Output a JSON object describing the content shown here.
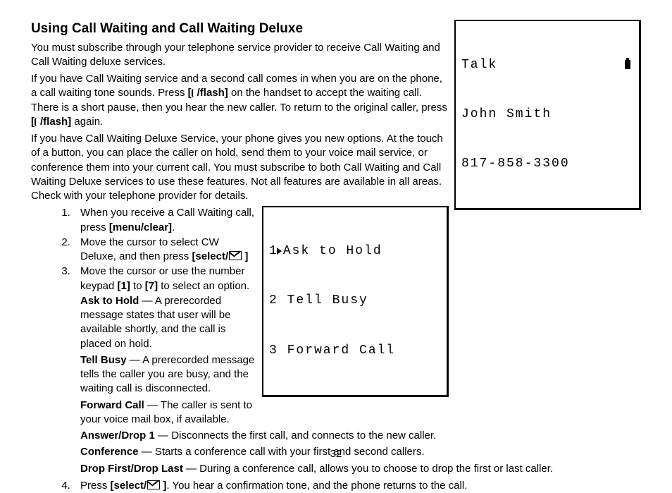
{
  "heading": "Using Call Waiting and Call Waiting Deluxe",
  "p1": "You must subscribe through your telephone service provider to receive Call Waiting and Call Waiting deluxe services.",
  "p2a": "If you have Call Waiting service and a second call comes in when you are on the phone, a call waiting tone sounds. Press ",
  "flash": "/flash]",
  "p2b": " on the handset to accept the waiting call. There is a short pause, then you hear the new caller. To return to the original caller, press ",
  "p2c": " again.",
  "p3": "If you have Call Waiting Deluxe Service, your phone gives you new options. At the touch of a button, you can place the caller on hold, send them to your voice mail service, or conference them into your current call. You must subscribe to both Call Waiting and Call Waiting Deluxe services to use these features. Not all features are available in all areas. Check with your telephone provider for details.",
  "screen1": {
    "l1": "Talk",
    "l2": "John Smith",
    "l3": "817-858-3300"
  },
  "screen2": {
    "l1": "Ask to Hold",
    "l2": "2 Tell Busy",
    "l3": "3 Forward Call"
  },
  "steps": {
    "s1a": "When you receive a Call Waiting call, press ",
    "s1b": "[menu/clear]",
    "s1c": ".",
    "s2a": "Move the cursor to select CW Deluxe, and then press ",
    "select": "[select/",
    "bracket_close": "]",
    "s3a": "Move the cursor or use the number keypad ",
    "s3b": "[1]",
    "s3c": " to ",
    "s3d": "[7]",
    "s3e": " to select an option.",
    "s4a": "Press ",
    "s4b": ". You hear a confirmation tone, and the phone returns to the call."
  },
  "opts": {
    "o1t": "Ask to Hold",
    "o1": " — A prerecorded message states that user will be available shortly, and the call is placed on hold.",
    "o2t": "Tell Busy",
    "o2": " — A prerecorded message tells the caller you are busy, and the waiting call is disconnected.",
    "o3t": "Forward Call",
    "o3": " — The caller is sent to your voice mail box, if available.",
    "o4t": "Answer/Drop 1",
    "o4": " — Disconnects the first call, and connects to the new caller.",
    "o5t": "Conference",
    "o5": " — Starts a conference call with your first and second callers.",
    "o6t": "Drop First/Drop Last",
    "o6": " — During a conference call, allows you to choose to drop the first or last caller."
  },
  "pagenum": "32"
}
